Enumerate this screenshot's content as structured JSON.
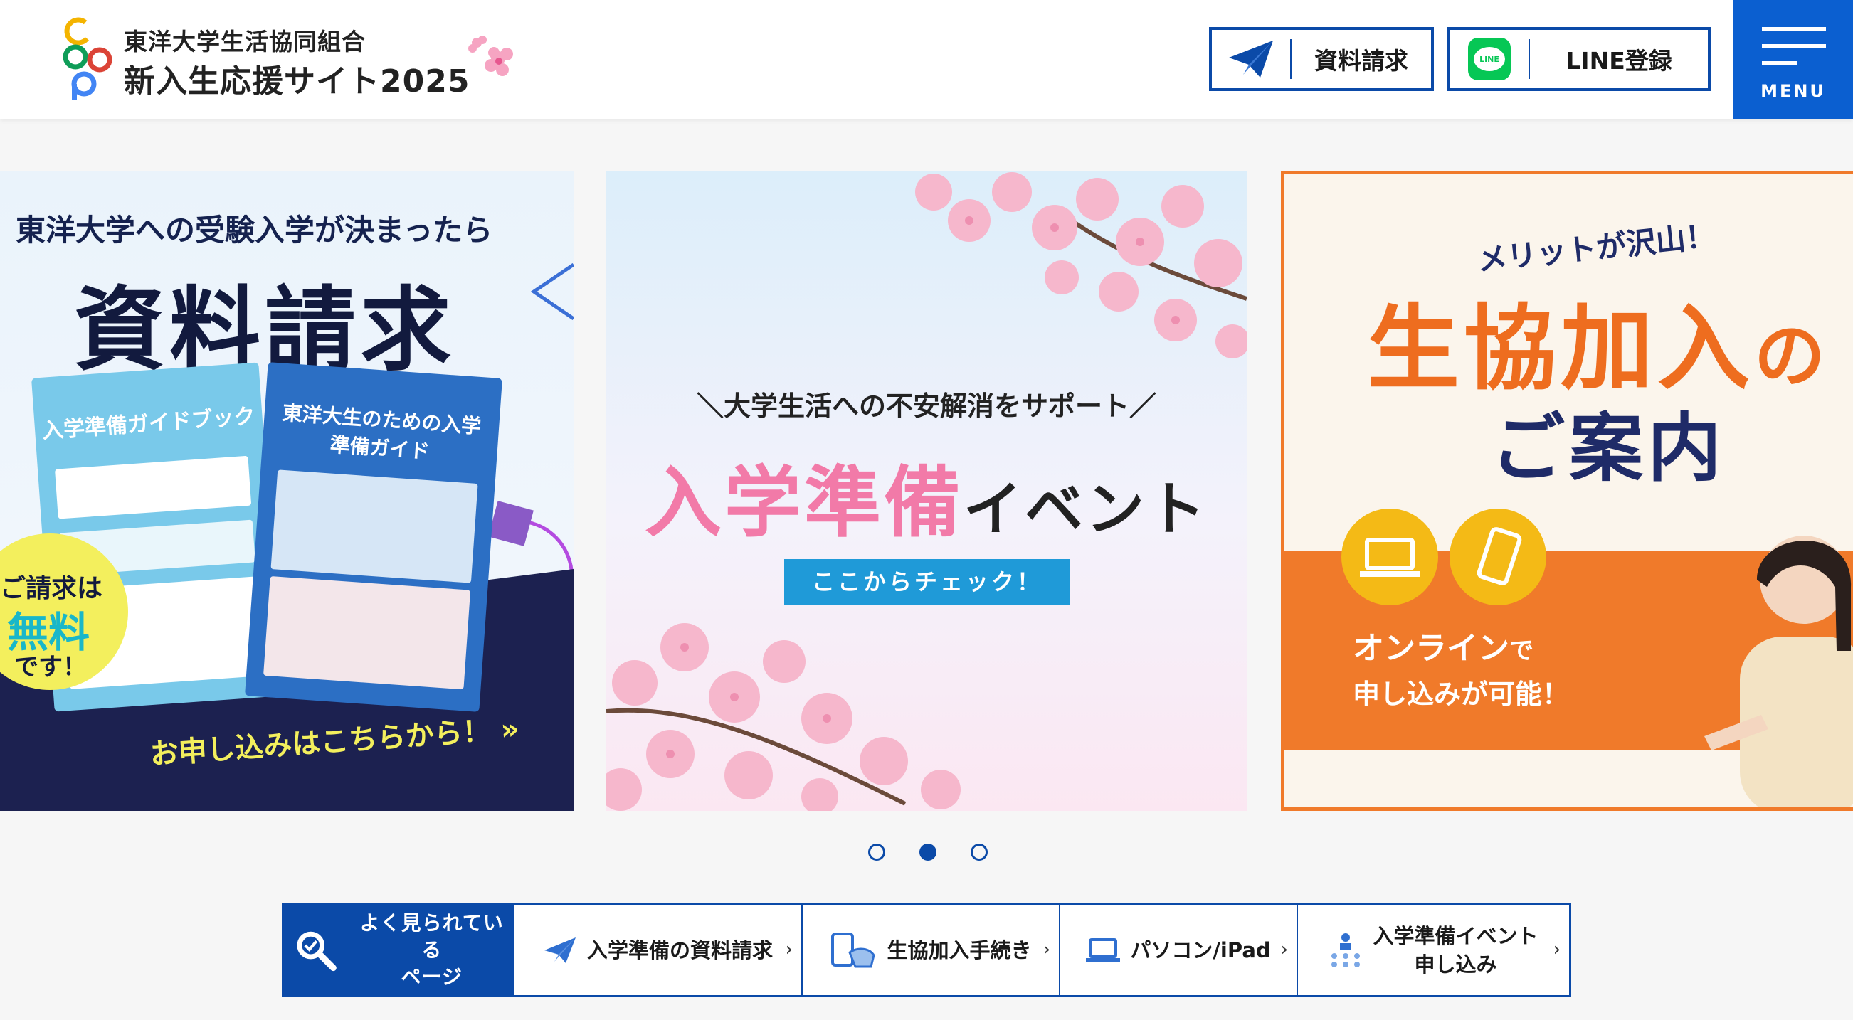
{
  "header": {
    "org_name": "東洋大学生活協同組合",
    "site_title": "新入生応援サイト2025",
    "buttons": {
      "request_label": "資料請求",
      "line_label": "LINE登録",
      "line_icon_text": "LINE"
    },
    "menu_label": "MENU"
  },
  "slides": [
    {
      "top_text": "東洋大学への受験入学が決まったら",
      "big_text": "資料請求",
      "brochure1_title": "入学準備ガイドブック",
      "brochure2_title": "東洋大生のための入学準備ガイド",
      "free_lines": [
        "ご請求は",
        "無料",
        "です！"
      ],
      "cta": "お申し込みはこちらから！ »"
    },
    {
      "sub_text": "＼大学生活への不安解消をサポート／",
      "main_pink": "入学準備",
      "main_dark": "イベント",
      "button_label": "ここからチェック！"
    },
    {
      "top_text": "メリットが沢山！",
      "big_text": "生協加入",
      "big_suffix": "の",
      "mid_text": "ご案内",
      "line1_bold": "オンライン",
      "line1_small": "で",
      "line2": "申し込みが可能！"
    }
  ],
  "carousel": {
    "count": 3,
    "active_index": 1
  },
  "quick_nav": {
    "heading": [
      "よく見られている",
      "ページ"
    ],
    "items": [
      {
        "label": "入学準備の資料請求",
        "icon": "paper-plane-icon"
      },
      {
        "label": "生協加入手続き",
        "icon": "smartphone-tap-icon"
      },
      {
        "label": "パソコン/iPad",
        "icon": "laptop-icon"
      },
      {
        "label_lines": [
          "入学準備イベント",
          "申し込み"
        ],
        "icon": "seminar-icon"
      }
    ]
  },
  "colors": {
    "primary": "#0b4aa8",
    "menu_bg": "#0b5fd0",
    "orange": "#f07a2a",
    "pink": "#f27aa8",
    "line_green": "#06c755"
  }
}
